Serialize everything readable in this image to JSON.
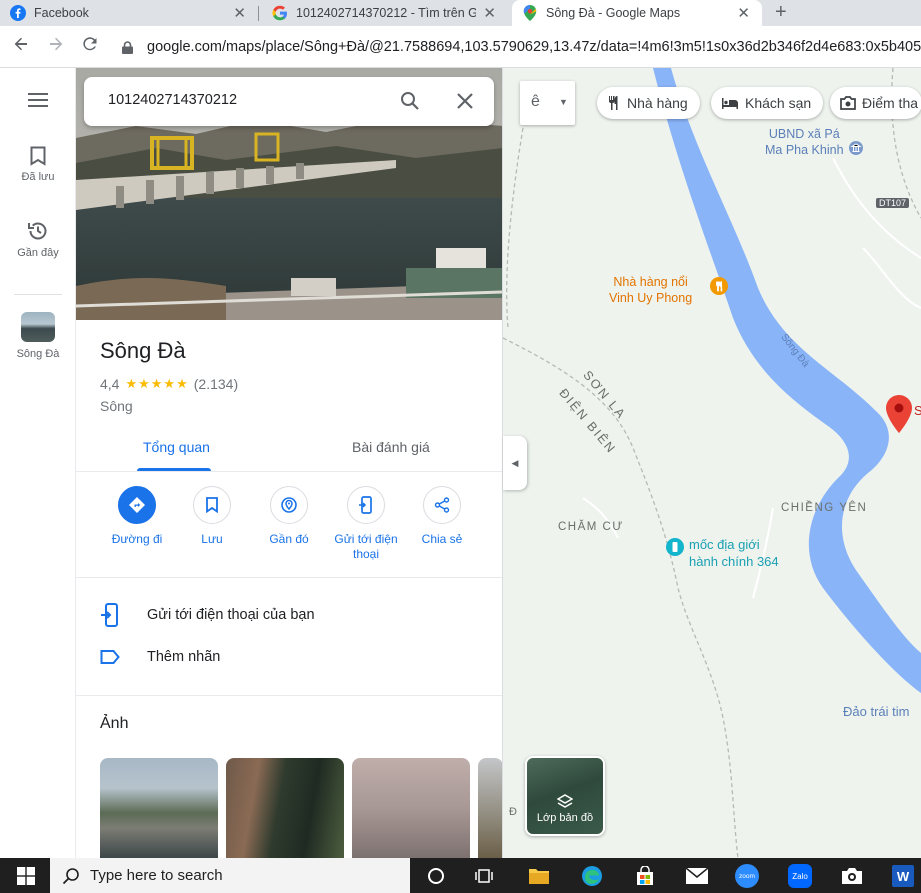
{
  "browser": {
    "tabs": [
      {
        "title": "Facebook",
        "icon": "facebook-icon",
        "active": false
      },
      {
        "title": "1012402714370212 - Tìm trên G",
        "icon": "google-icon",
        "active": false
      },
      {
        "title": "Sông Đà - Google Maps",
        "icon": "maps-pin-icon",
        "active": true
      }
    ],
    "url": "google.com/maps/place/Sông+Đà/@21.7588694,103.5790629,13.47z/data=!4m6!3m5!1s0x36d2b346f2d4e683:0x5b405"
  },
  "rail": {
    "saved_label": "Đã lưu",
    "recent_label": "Gần đây",
    "place_label": "Sông Đà"
  },
  "search": {
    "query": "1012402714370212"
  },
  "place": {
    "name": "Sông Đà",
    "rating": "4,4",
    "stars": "★★★★★",
    "reviews": "(2.134)",
    "category": "Sông",
    "tabs": {
      "overview": "Tổng quan",
      "reviews": "Bài đánh giá"
    },
    "actions": {
      "directions": "Đường đi",
      "save": "Lưu",
      "nearby": "Gần đó",
      "send_to_phone": "Gửi tới điện thoại",
      "share": "Chia sẻ"
    },
    "rows": {
      "send_to_phone": "Gửi tới điện thoại của bạn",
      "add_label": "Thêm nhãn"
    },
    "photos_title": "Ảnh"
  },
  "map": {
    "lang_button": "ê",
    "chips": {
      "restaurants": "Nhà hàng",
      "hotels": "Khách sạn",
      "attractions": "Điểm tha"
    },
    "labels": {
      "ubnd_line1": "UBND xã Pá",
      "ubnd_line2": "Ma Pha Khinh",
      "road": "DT107",
      "restaurant_line1": "Nhà hàng nổi",
      "restaurant_line2": "Vinh Uy Phong",
      "river": "Sông Đà",
      "son_la": "SƠN LA",
      "dien_bien": "ĐIỆN BIÊN",
      "chieng_yen": "CHIỀNG YÊN",
      "cham_cu": "CHĂM CƯ",
      "boundary_line1": "mốc địa giới",
      "boundary_line2": "hành chính 364",
      "dao_trai": "Đảo trái tim",
      "pin_label": "S",
      "small_d": "Đ"
    },
    "layers_label": "Lớp bản đồ"
  },
  "taskbar": {
    "search_placeholder": "Type here to search",
    "zoom_label": "zoom",
    "zalo_label": "Zalo",
    "word_label": "W"
  },
  "colors": {
    "accent": "#1a73e8",
    "river": "#8ab4f8",
    "star": "#fbbc04",
    "pin": "#ea4335"
  }
}
